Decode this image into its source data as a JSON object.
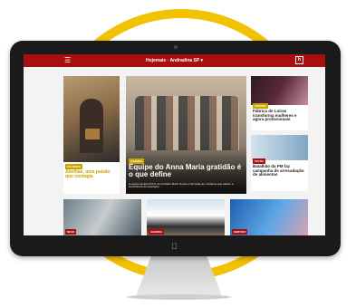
{
  "site": {
    "title": "Hojemais · Andradina SP ▾",
    "logo": "h",
    "menu_icon": "hamburger-icon"
  },
  "cards": {
    "left": {
      "tag": "VALORIZA",
      "headline": "Abelhas, uma paixão que contagia"
    },
    "featured": {
      "tag": "AGENDA",
      "headline": "Equipe do Anna Maria gratidão é o que define",
      "summary": "A equipe da Emef Prof. Anna Maria Marin Nunes é formada por mulheres que sabem a importância da educação"
    },
    "right_top": {
      "tag": "AGENDA",
      "headline": "Fábrica de Loiras transforma mulheres e agora profissionais"
    },
    "right_mid": {
      "tag": "EXTRA",
      "headline": "Batalhão da PM faz campanha de arrecadação de alimentos"
    },
    "bottom1": {
      "tag": "NOVA"
    },
    "bottom2": {
      "tag": "AGENDA"
    },
    "bottom3": {
      "tag": "SERVIÇO"
    }
  },
  "colors": {
    "brand": "#a80f0f",
    "ring": "#f2c200",
    "tag_gold": "#c9a400"
  }
}
